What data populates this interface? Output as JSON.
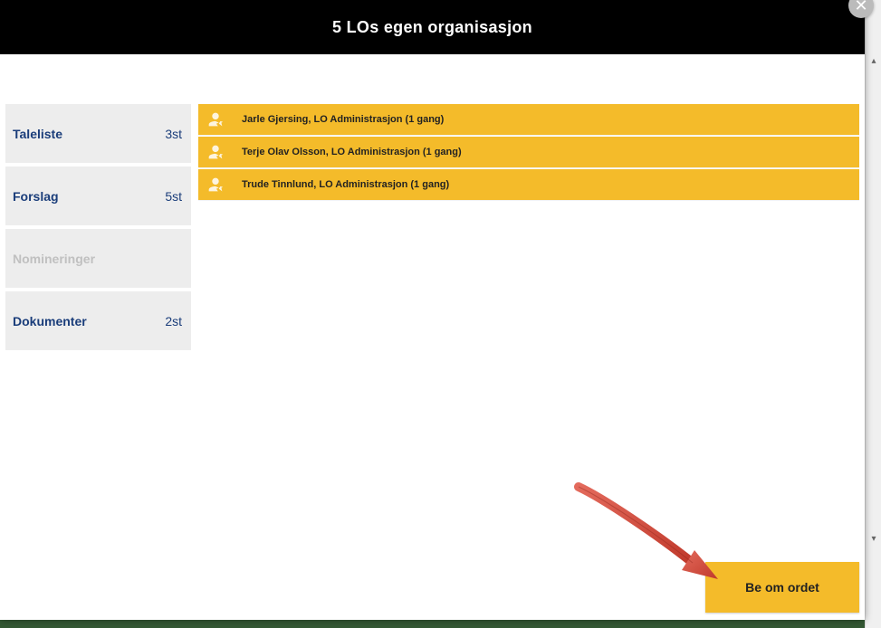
{
  "header": {
    "title": "5 LOs egen organisasjon"
  },
  "sidebar": {
    "tabs": [
      {
        "label": "Taleliste",
        "count": "3st",
        "disabled": false
      },
      {
        "label": "Forslag",
        "count": "5st",
        "disabled": false
      },
      {
        "label": "Nomineringer",
        "count": "",
        "disabled": true
      },
      {
        "label": "Dokumenter",
        "count": "2st",
        "disabled": false
      }
    ]
  },
  "speakers": [
    {
      "text": "Jarle Gjersing, LO Administrasjon (1 gang)"
    },
    {
      "text": "Terje Olav  Olsson, LO Administrasjon (1 gang)"
    },
    {
      "text": "Trude Tinnlund, LO Administrasjon (1 gang)"
    }
  ],
  "action": {
    "label": "Be om ordet"
  }
}
